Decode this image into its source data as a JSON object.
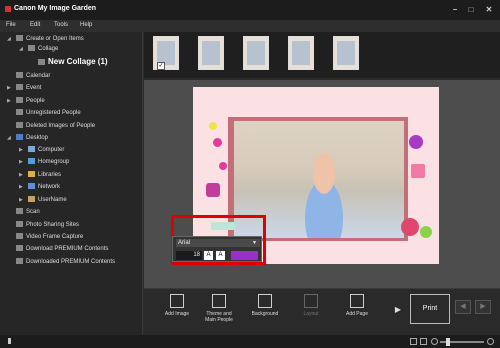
{
  "window": {
    "title": "Canon My Image Garden",
    "minimize": "–",
    "maximize": "□",
    "close": "✕"
  },
  "menu": [
    "File",
    "Edit",
    "Tools",
    "Help"
  ],
  "sidebar": {
    "items": [
      {
        "label": "Create or Open Items"
      },
      {
        "label": "Collage"
      },
      {
        "label": "New Collage (1)"
      },
      {
        "label": "Calendar"
      },
      {
        "label": "Event"
      },
      {
        "label": "People"
      },
      {
        "label": "Unregistered People"
      },
      {
        "label": "Deleted Images of People"
      },
      {
        "label": "Desktop"
      },
      {
        "label": "Computer"
      },
      {
        "label": "Homegroup"
      },
      {
        "label": "Libraries"
      },
      {
        "label": "Network"
      },
      {
        "label": "UserName"
      },
      {
        "label": "Scan"
      },
      {
        "label": "Photo Sharing Sites"
      },
      {
        "label": "Video Frame Capture"
      },
      {
        "label": "Download PREMIUM Contents"
      },
      {
        "label": "Downloaded PREMIUM Contents"
      }
    ]
  },
  "font_toolbar": {
    "font": "Arial",
    "size": "18",
    "color": "#9b30c8"
  },
  "toolbar": {
    "add_image": "Add Image",
    "theme_line1": "Theme and",
    "theme_line2": "Main People",
    "background": "Background",
    "layout": "Layout",
    "add_page": "Add Page",
    "print": "Print"
  },
  "colors": {
    "accent_red": "#e00000",
    "canvas_bg": "#fbe1e4"
  }
}
